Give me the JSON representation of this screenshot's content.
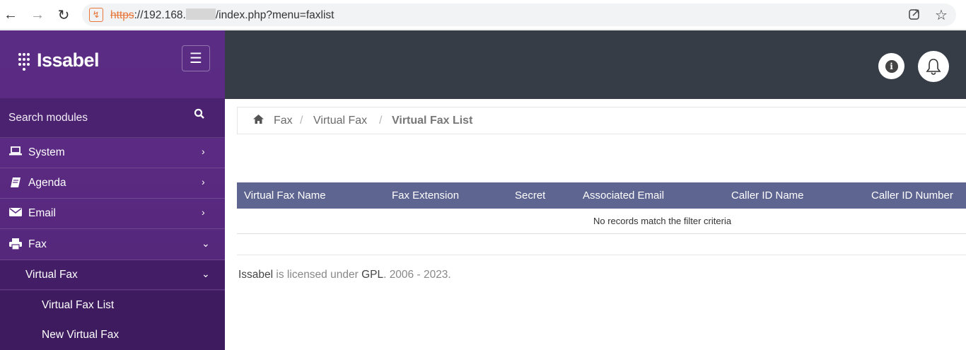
{
  "browser": {
    "url_scheme": "https",
    "url_host": "://192.168.",
    "url_path": "/index.php?menu=faxlist"
  },
  "brand": {
    "name": "Issabel"
  },
  "sidebar": {
    "search_label": "Search modules",
    "items": [
      {
        "label": "System",
        "icon": "laptop-icon"
      },
      {
        "label": "Agenda",
        "icon": "book-icon"
      },
      {
        "label": "Email",
        "icon": "envelope-icon"
      },
      {
        "label": "Fax",
        "icon": "printer-icon"
      }
    ],
    "submenu": {
      "label": "Virtual Fax"
    },
    "subitems": [
      {
        "label": "Virtual Fax List"
      },
      {
        "label": "New Virtual Fax"
      }
    ]
  },
  "breadcrumb": {
    "level1": "Fax",
    "level2": "Virtual Fax",
    "current": "Virtual Fax List"
  },
  "table": {
    "columns": [
      "Virtual Fax Name",
      "Fax Extension",
      "Secret",
      "Associated Email",
      "Caller ID Name",
      "Caller ID Number"
    ],
    "empty_message": "No records match the filter criteria"
  },
  "footer": {
    "product": "Issabel",
    "mid": " is licensed under ",
    "license": "GPL",
    "years": ". 2006 - 2023."
  },
  "colors": {
    "sidebar": "#5b2c84",
    "topbar": "#363d47",
    "table_header": "#5e6590"
  }
}
